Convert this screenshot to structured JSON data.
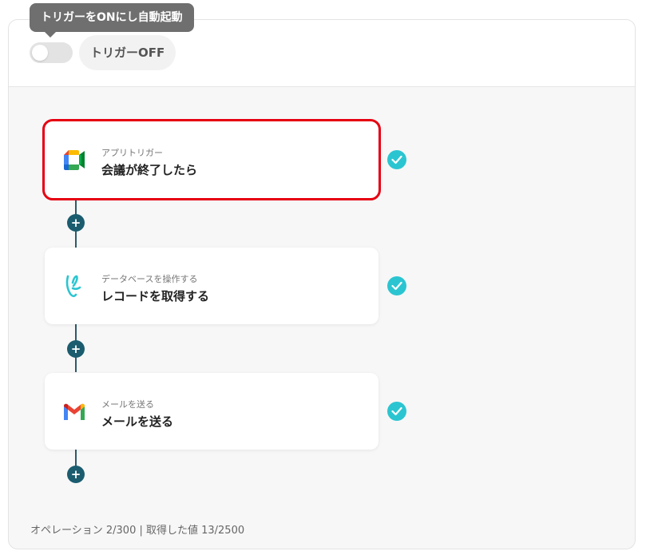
{
  "tooltip": {
    "text": "トリガーをONにし自動起動"
  },
  "trigger": {
    "status_label": "トリガーOFF",
    "enabled": false
  },
  "steps": [
    {
      "category": "アプリトリガー",
      "title": "会議が終了したら",
      "icon": "google-meet-icon",
      "selected": true,
      "completed": true
    },
    {
      "category": "データベースを操作する",
      "title": "レコードを取得する",
      "icon": "yoom-database-icon",
      "selected": false,
      "completed": true
    },
    {
      "category": "メールを送る",
      "title": "メールを送る",
      "icon": "gmail-icon",
      "selected": false,
      "completed": true
    }
  ],
  "add_step_label": "+",
  "footer": {
    "text": "オペレーション 2/300 | 取得した値 13/2500"
  },
  "colors": {
    "accent": "#2bc5d1",
    "connector": "#1b5c6f",
    "selection": "#e60012"
  }
}
